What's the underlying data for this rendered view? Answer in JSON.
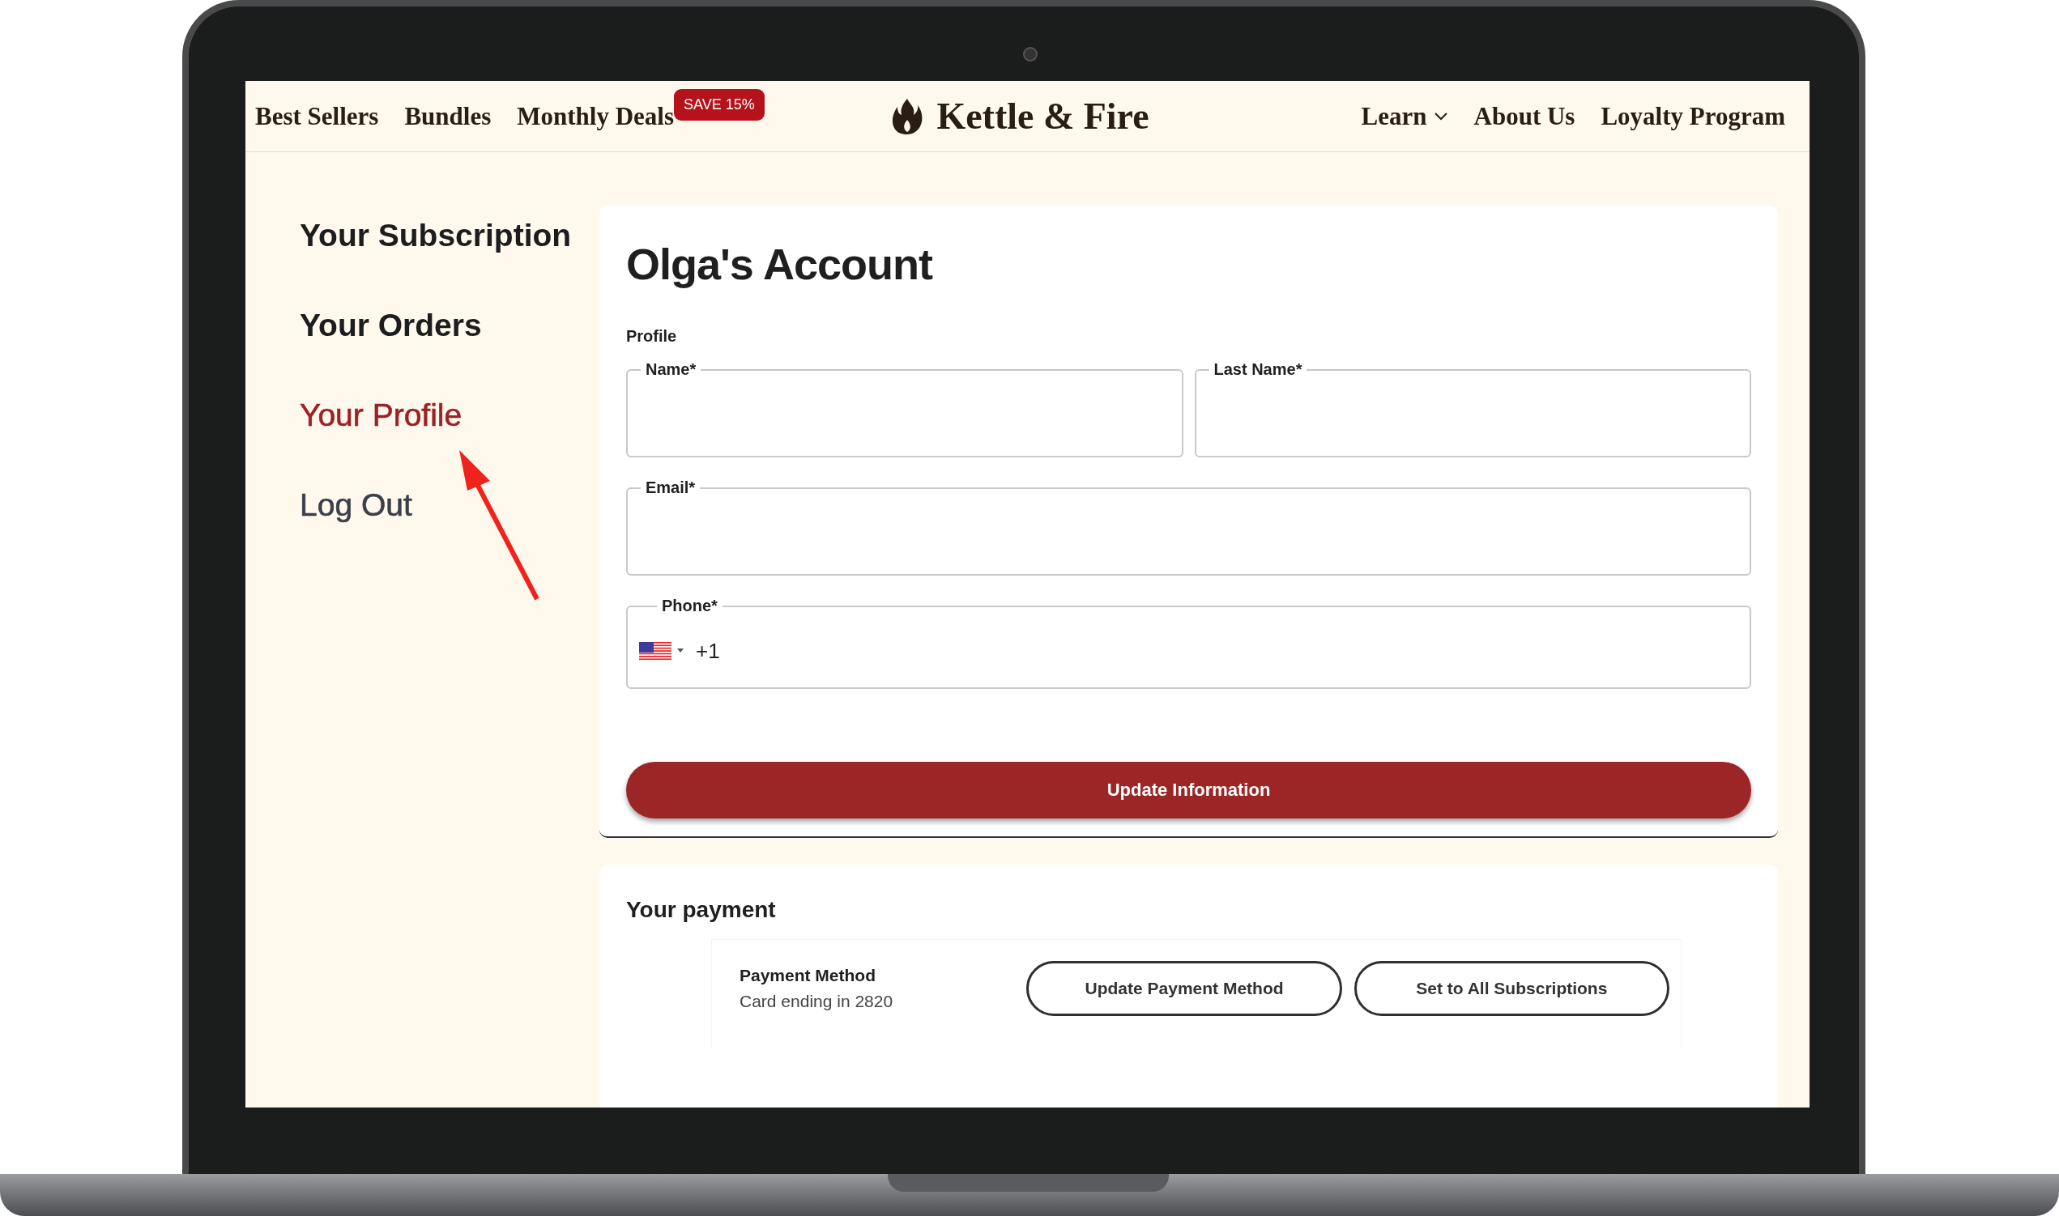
{
  "nav": {
    "left": [
      {
        "label": "Best Sellers"
      },
      {
        "label": "Bundles"
      },
      {
        "label": "Monthly Deals",
        "badge": "SAVE 15%"
      }
    ],
    "logo": "Kettle & Fire",
    "right": [
      {
        "label": "Learn",
        "dropdown": true
      },
      {
        "label": "About Us",
        "dropdown": false
      },
      {
        "label": "Loyalty Program",
        "dropdown": false
      }
    ]
  },
  "sidebar": {
    "items": [
      {
        "label": "Your Subscription",
        "selected": false
      },
      {
        "label": "Your Orders",
        "selected": false
      },
      {
        "label": "Your Profile",
        "selected": true
      },
      {
        "label": "Log Out",
        "selected": false
      }
    ]
  },
  "account": {
    "title": "Olga's Account",
    "section": "Profile",
    "rows": [
      [
        {
          "label": "Name*",
          "kind": "text"
        },
        {
          "label": "Last Name*",
          "kind": "text"
        }
      ],
      [
        {
          "label": "Email*",
          "kind": "text"
        }
      ],
      [
        {
          "label": "Phone*",
          "kind": "phone",
          "prefix": "+1"
        }
      ]
    ],
    "button": "Update Information"
  },
  "payment": {
    "title": "Your payment",
    "method_label": "Payment Method",
    "method_detail": "Card ending in 2820",
    "buttons": [
      "Update Payment Method",
      "Set to All Subscriptions"
    ]
  }
}
